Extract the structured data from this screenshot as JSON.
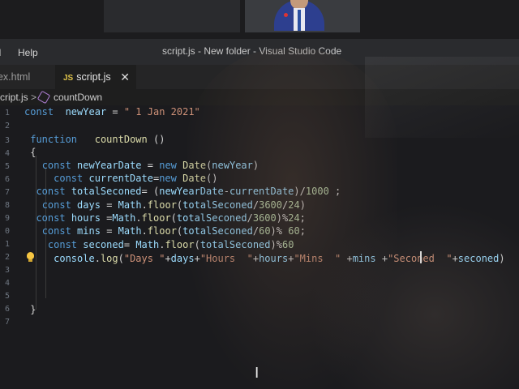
{
  "window": {
    "menu_view": "al",
    "menu_help": "Help",
    "title": "script.js - New folder - Visual Studio Code"
  },
  "tabs": [
    {
      "label": "dex.html",
      "active": false
    },
    {
      "label": "script.js",
      "icon_text": "JS",
      "active": true,
      "close": "✕"
    }
  ],
  "breadcrumb": {
    "file": "script.js",
    "separator": ">",
    "symbol_icon": "cube-method-icon",
    "symbol": "countDown"
  },
  "editor": {
    "line_numbers": [
      "1",
      "2",
      "3",
      "4",
      "5",
      "6",
      "7",
      "8",
      "9",
      "0",
      "1",
      "2",
      "3",
      "4",
      "5",
      "6",
      "7"
    ],
    "lines": [
      "const  newYear = \" 1 Jan 2021\"",
      "",
      " function   countDown ()",
      " {",
      "   const newYearDate = new Date(newYear)",
      "     const currentDate=new Date()",
      "  const totalSeconed= (newYearDate-currentDate)/1000 ;",
      "   const days = Math.floor(totalSeconed/3600/24)",
      "  const hours =Math.floor(totalSeconed/3600)%24;",
      "   const mins = Math.floor(totalSeconed/60)% 60;",
      "    const seconed= Math.floor(totalSeconed)%60",
      "     console.log(\"Days \"+days+\"Hours  \"+hours+\"Mins  \" +mins +\"Seconed  \"+seconed)",
      "",
      "",
      "",
      " }",
      ""
    ]
  },
  "colors": {
    "keyword": "#569cd6",
    "variable": "#9cdcfe",
    "function": "#dcdcaa",
    "string": "#ce9178",
    "number": "#b5cea8",
    "background": "#1e1e1e"
  }
}
